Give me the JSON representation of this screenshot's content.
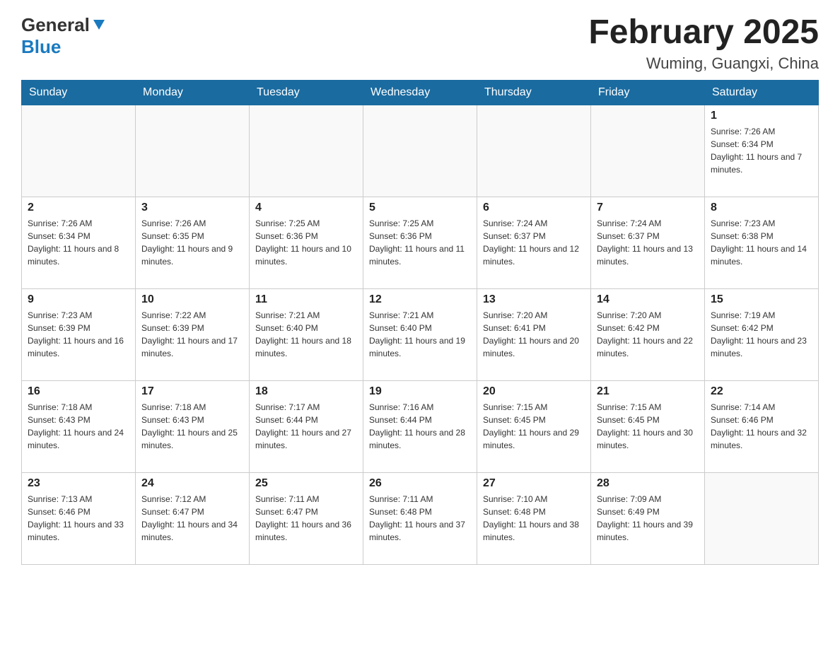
{
  "header": {
    "logo_general": "General",
    "logo_blue": "Blue",
    "month_title": "February 2025",
    "location": "Wuming, Guangxi, China"
  },
  "days_of_week": [
    "Sunday",
    "Monday",
    "Tuesday",
    "Wednesday",
    "Thursday",
    "Friday",
    "Saturday"
  ],
  "weeks": [
    [
      {
        "day": "",
        "info": ""
      },
      {
        "day": "",
        "info": ""
      },
      {
        "day": "",
        "info": ""
      },
      {
        "day": "",
        "info": ""
      },
      {
        "day": "",
        "info": ""
      },
      {
        "day": "",
        "info": ""
      },
      {
        "day": "1",
        "info": "Sunrise: 7:26 AM\nSunset: 6:34 PM\nDaylight: 11 hours and 7 minutes."
      }
    ],
    [
      {
        "day": "2",
        "info": "Sunrise: 7:26 AM\nSunset: 6:34 PM\nDaylight: 11 hours and 8 minutes."
      },
      {
        "day": "3",
        "info": "Sunrise: 7:26 AM\nSunset: 6:35 PM\nDaylight: 11 hours and 9 minutes."
      },
      {
        "day": "4",
        "info": "Sunrise: 7:25 AM\nSunset: 6:36 PM\nDaylight: 11 hours and 10 minutes."
      },
      {
        "day": "5",
        "info": "Sunrise: 7:25 AM\nSunset: 6:36 PM\nDaylight: 11 hours and 11 minutes."
      },
      {
        "day": "6",
        "info": "Sunrise: 7:24 AM\nSunset: 6:37 PM\nDaylight: 11 hours and 12 minutes."
      },
      {
        "day": "7",
        "info": "Sunrise: 7:24 AM\nSunset: 6:37 PM\nDaylight: 11 hours and 13 minutes."
      },
      {
        "day": "8",
        "info": "Sunrise: 7:23 AM\nSunset: 6:38 PM\nDaylight: 11 hours and 14 minutes."
      }
    ],
    [
      {
        "day": "9",
        "info": "Sunrise: 7:23 AM\nSunset: 6:39 PM\nDaylight: 11 hours and 16 minutes."
      },
      {
        "day": "10",
        "info": "Sunrise: 7:22 AM\nSunset: 6:39 PM\nDaylight: 11 hours and 17 minutes."
      },
      {
        "day": "11",
        "info": "Sunrise: 7:21 AM\nSunset: 6:40 PM\nDaylight: 11 hours and 18 minutes."
      },
      {
        "day": "12",
        "info": "Sunrise: 7:21 AM\nSunset: 6:40 PM\nDaylight: 11 hours and 19 minutes."
      },
      {
        "day": "13",
        "info": "Sunrise: 7:20 AM\nSunset: 6:41 PM\nDaylight: 11 hours and 20 minutes."
      },
      {
        "day": "14",
        "info": "Sunrise: 7:20 AM\nSunset: 6:42 PM\nDaylight: 11 hours and 22 minutes."
      },
      {
        "day": "15",
        "info": "Sunrise: 7:19 AM\nSunset: 6:42 PM\nDaylight: 11 hours and 23 minutes."
      }
    ],
    [
      {
        "day": "16",
        "info": "Sunrise: 7:18 AM\nSunset: 6:43 PM\nDaylight: 11 hours and 24 minutes."
      },
      {
        "day": "17",
        "info": "Sunrise: 7:18 AM\nSunset: 6:43 PM\nDaylight: 11 hours and 25 minutes."
      },
      {
        "day": "18",
        "info": "Sunrise: 7:17 AM\nSunset: 6:44 PM\nDaylight: 11 hours and 27 minutes."
      },
      {
        "day": "19",
        "info": "Sunrise: 7:16 AM\nSunset: 6:44 PM\nDaylight: 11 hours and 28 minutes."
      },
      {
        "day": "20",
        "info": "Sunrise: 7:15 AM\nSunset: 6:45 PM\nDaylight: 11 hours and 29 minutes."
      },
      {
        "day": "21",
        "info": "Sunrise: 7:15 AM\nSunset: 6:45 PM\nDaylight: 11 hours and 30 minutes."
      },
      {
        "day": "22",
        "info": "Sunrise: 7:14 AM\nSunset: 6:46 PM\nDaylight: 11 hours and 32 minutes."
      }
    ],
    [
      {
        "day": "23",
        "info": "Sunrise: 7:13 AM\nSunset: 6:46 PM\nDaylight: 11 hours and 33 minutes."
      },
      {
        "day": "24",
        "info": "Sunrise: 7:12 AM\nSunset: 6:47 PM\nDaylight: 11 hours and 34 minutes."
      },
      {
        "day": "25",
        "info": "Sunrise: 7:11 AM\nSunset: 6:47 PM\nDaylight: 11 hours and 36 minutes."
      },
      {
        "day": "26",
        "info": "Sunrise: 7:11 AM\nSunset: 6:48 PM\nDaylight: 11 hours and 37 minutes."
      },
      {
        "day": "27",
        "info": "Sunrise: 7:10 AM\nSunset: 6:48 PM\nDaylight: 11 hours and 38 minutes."
      },
      {
        "day": "28",
        "info": "Sunrise: 7:09 AM\nSunset: 6:49 PM\nDaylight: 11 hours and 39 minutes."
      },
      {
        "day": "",
        "info": ""
      }
    ]
  ]
}
